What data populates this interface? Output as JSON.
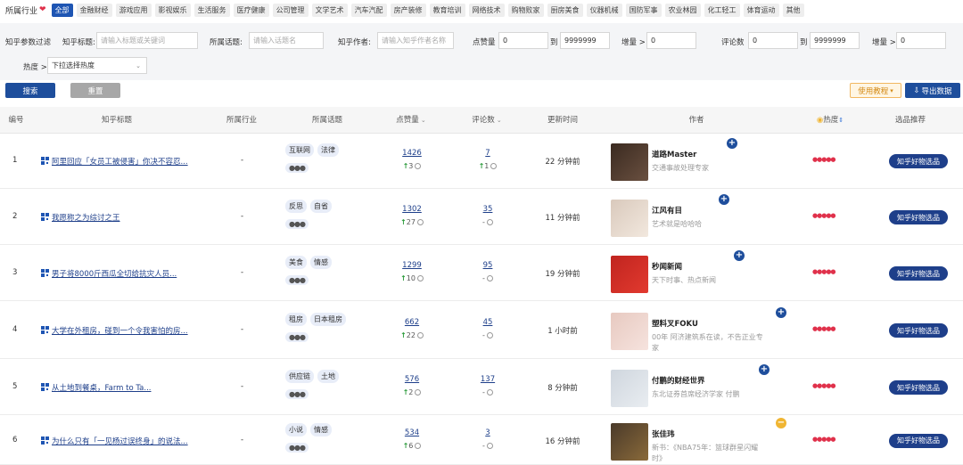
{
  "industry": {
    "label": "所属行业",
    "chips": [
      "全部",
      "金融财经",
      "游戏应用",
      "影视娱乐",
      "生活服务",
      "医疗健康",
      "公司管理",
      "文学艺术",
      "汽车汽配",
      "房产装修",
      "教育培训",
      "网络技术",
      "购物败家",
      "厨房美食",
      "仪器机械",
      "国防军事",
      "农业林园",
      "化工轻工",
      "体育运动",
      "其他"
    ],
    "active_index": 0
  },
  "filters": {
    "section_label": "知乎参数过滤",
    "title_label": "知乎标题:",
    "title_placeholder": "请输入标题或关键词",
    "topic_label": "所属话题:",
    "topic_placeholder": "请输入话题名",
    "author_label": "知乎作者:",
    "author_placeholder": "请输入知乎作者名称",
    "likes_label": "点赞量",
    "likes_min": "0",
    "to_label_1": "到",
    "likes_max": "9999999",
    "likes_inc_label": "增量 >",
    "likes_inc": "0",
    "comments_label": "评论数",
    "comments_min": "0",
    "to_label_2": "到",
    "comments_max": "9999999",
    "comments_inc_label": "增量 >",
    "comments_inc": "0",
    "heat_label": "热度 >",
    "heat_select": "下拉选择热度"
  },
  "actions": {
    "search": "搜索",
    "reset": "重置",
    "guide": "使用教程",
    "export": "导出数据"
  },
  "table": {
    "headers": {
      "index": "编号",
      "title": "知乎标题",
      "industry": "所属行业",
      "topic": "所属话题",
      "likes": "点赞量",
      "comments": "评论数",
      "updated": "更新时间",
      "author": "作者",
      "heat": "热度",
      "rec": "选品推荐"
    },
    "rows": [
      {
        "index": "1",
        "title": "阿里回应「女员工被侵害」你决不容忍...",
        "industry": "-",
        "topics": [
          "互联网",
          "法律"
        ],
        "more": "●●●",
        "likes": "1426",
        "likes_inc": "3",
        "likes_up": true,
        "comments": "7",
        "comments_inc": "1",
        "comments_up": true,
        "updated": "22 分钟前",
        "author": "道路Master",
        "desc": "交通事故处理专家",
        "plus": "blue",
        "rec": "知乎好物选品"
      },
      {
        "index": "2",
        "title": "我愿称之为综讨之王",
        "industry": "-",
        "topics": [
          "反思",
          "自省"
        ],
        "more": "●●●",
        "likes": "1302",
        "likes_inc": "27",
        "likes_up": true,
        "comments": "35",
        "comments_inc": "-",
        "comments_up": false,
        "updated": "11 分钟前",
        "author": "江风有目",
        "desc": "艺术就是哈哈哈",
        "plus": "blue",
        "rec": "知乎好物选品"
      },
      {
        "index": "3",
        "title": "男子将8000斤西瓜全切给抗灾人员...",
        "industry": "-",
        "topics": [
          "美食",
          "情感"
        ],
        "more": "●●●",
        "likes": "1299",
        "likes_inc": "10",
        "likes_up": true,
        "comments": "95",
        "comments_inc": "-",
        "comments_up": false,
        "updated": "19 分钟前",
        "author": "秒闻新闻",
        "desc": "天下时事、热点新闻",
        "plus": "blue",
        "rec": "知乎好物选品"
      },
      {
        "index": "4",
        "title": "大学在外租房，碰到一个令我害怕的房...",
        "industry": "-",
        "topics": [
          "租房",
          "日本租房"
        ],
        "more": "●●●",
        "likes": "662",
        "likes_inc": "22",
        "likes_up": true,
        "comments": "45",
        "comments_inc": "-",
        "comments_up": false,
        "updated": "1 小时前",
        "author": "塑料叉FOKU",
        "desc": "00年 阿济建筑系在读，不告正业专家",
        "plus": "blue",
        "rec": "知乎好物选品"
      },
      {
        "index": "5",
        "title": "从土地到餐桌，Farm to Ta...",
        "industry": "-",
        "topics": [
          "供应链",
          "土地"
        ],
        "more": "●●●",
        "likes": "576",
        "likes_inc": "2",
        "likes_up": true,
        "comments": "137",
        "comments_inc": "-",
        "comments_up": false,
        "updated": "8 分钟前",
        "author": "付鹏的财经世界",
        "desc": "东北证券首席经济学家 付鹏",
        "plus": "blue",
        "rec": "知乎好物选品"
      },
      {
        "index": "6",
        "title": "为什么只有「一见杨过误终身」的说法...",
        "industry": "-",
        "topics": [
          "小说",
          "情感"
        ],
        "more": "●●●",
        "likes": "534",
        "likes_inc": "6",
        "likes_up": true,
        "comments": "3",
        "comments_inc": "-",
        "comments_up": false,
        "updated": "16 分钟前",
        "author": "张佳玮",
        "desc": "新书：《NBA75年：篮球群星闪耀时》",
        "plus": "yellow",
        "rec": "知乎好物选品"
      }
    ]
  }
}
